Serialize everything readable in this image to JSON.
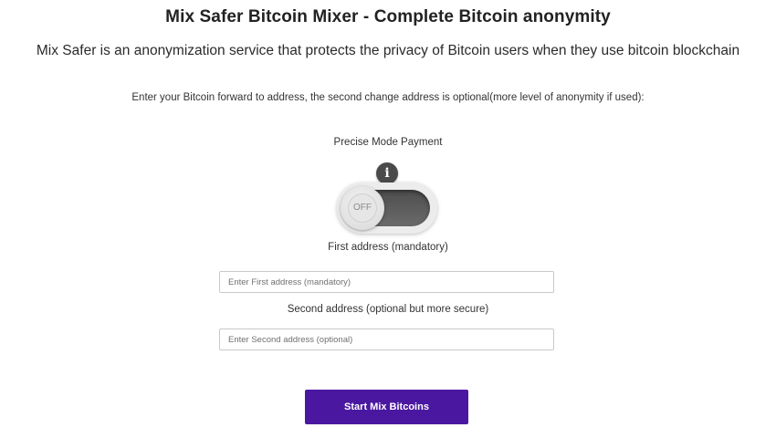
{
  "header": {
    "title": "Mix Safer Bitcoin Mixer - Complete Bitcoin anonymity",
    "subtitle": "Mix Safer is an anonymization service that protects the privacy of Bitcoin users when they use bitcoin blockchain"
  },
  "form": {
    "instruction": "Enter your Bitcoin forward to address, the second change address is optional(more level of anonymity if used):",
    "mode": {
      "label": "Precise Mode Payment",
      "info_icon": "info-icon",
      "info_glyph": "i",
      "toggle_state": "OFF",
      "enabled": false
    },
    "first_address": {
      "label": "First address (mandatory)",
      "value": "",
      "placeholder": "Enter First address (mandatory)"
    },
    "second_address": {
      "label": "Second address (optional but more secure)",
      "value": "",
      "placeholder": "Enter Second address (optional)"
    },
    "submit_label": "Start Mix Bitcoins"
  },
  "colors": {
    "accent": "#4a18a0",
    "toggle_track": "#5a5a5a",
    "info_icon_bg": "#4a4a4a",
    "text": "#2b2b2b"
  }
}
